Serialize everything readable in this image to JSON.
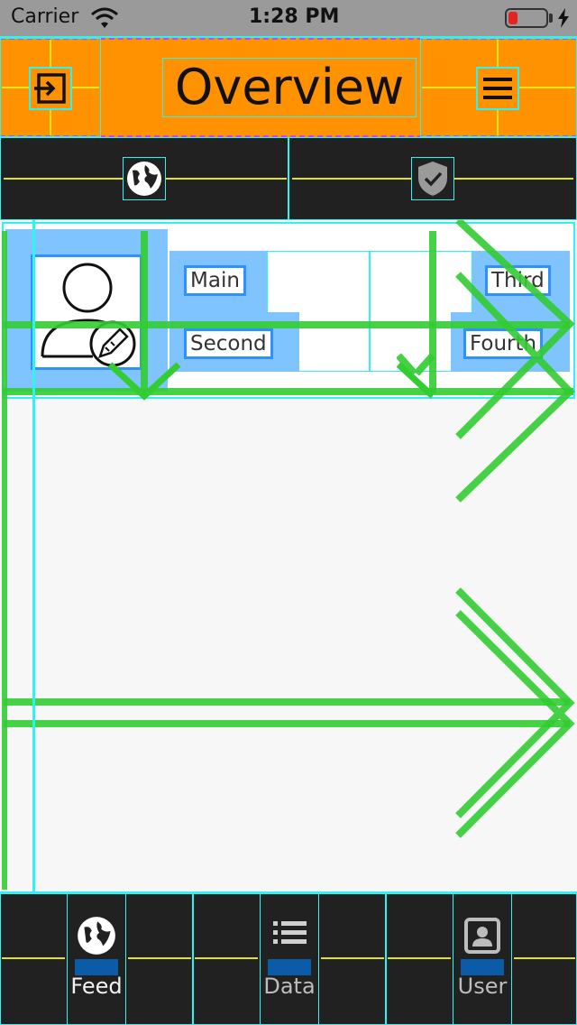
{
  "status_bar": {
    "carrier": "Carrier",
    "time": "1:28 PM"
  },
  "header": {
    "title": "Overview",
    "left_icon": "enter-icon",
    "right_icon": "menu-icon"
  },
  "toolbar": {
    "left_icon": "globe-icon",
    "right_icon": "shield-check-icon"
  },
  "profile": {
    "avatar_icon": "user-edit-icon",
    "buttons": [
      "Main",
      "Second",
      "Third",
      "Fourth"
    ]
  },
  "tabbar": {
    "items": [
      {
        "label": "Feed",
        "icon": "globe-icon"
      },
      {
        "label": "Data",
        "icon": "list-icon"
      },
      {
        "label": "User",
        "icon": "contact-icon"
      }
    ]
  },
  "colors": {
    "header": "#ff9200",
    "dark_bar": "#212121",
    "guide_cyan": "#2ff3f0",
    "guide_yellow": "#e3e31a",
    "guide_green": "#33cc33",
    "chip_blue": "#7fc3ff",
    "battery_low": "#e52421"
  }
}
